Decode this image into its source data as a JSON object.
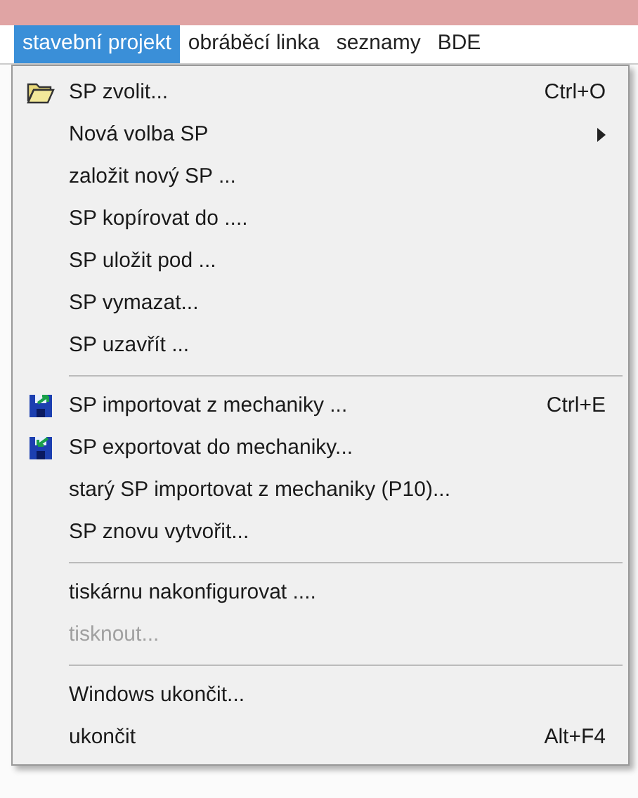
{
  "menubar": [
    {
      "label": "stavební projekt",
      "selected": true
    },
    {
      "label": "obráběcí linka",
      "selected": false
    },
    {
      "label": "seznamy",
      "selected": false
    },
    {
      "label": "BDE",
      "selected": false
    }
  ],
  "menu": [
    {
      "kind": "folder",
      "label": "SP zvolit...",
      "shortcut": "Ctrl+O",
      "disabled": false
    },
    {
      "kind": "item",
      "label": "Nová volba SP",
      "submenu": true,
      "disabled": false
    },
    {
      "kind": "item",
      "label": "založit nový SP ...",
      "disabled": false
    },
    {
      "kind": "item",
      "label": "SP kopírovat do ....",
      "disabled": false
    },
    {
      "kind": "item",
      "label": "SP uložit pod ...",
      "disabled": false
    },
    {
      "kind": "item",
      "label": "SP vymazat...",
      "disabled": false
    },
    {
      "kind": "item",
      "label": "SP uzavřít ...",
      "disabled": false
    },
    {
      "kind": "separator"
    },
    {
      "kind": "import",
      "label": "SP importovat z mechaniky ...",
      "shortcut": "Ctrl+E",
      "disabled": false
    },
    {
      "kind": "export",
      "label": "SP exportovat do mechaniky...",
      "disabled": false
    },
    {
      "kind": "item",
      "label": "starý SP importovat z mechaniky (P10)...",
      "disabled": false
    },
    {
      "kind": "item",
      "label": "SP znovu vytvořit...",
      "disabled": false
    },
    {
      "kind": "separator"
    },
    {
      "kind": "item",
      "label": "tiskárnu nakonfigurovat ....",
      "disabled": false
    },
    {
      "kind": "item",
      "label": "tisknout...",
      "disabled": true
    },
    {
      "kind": "separator"
    },
    {
      "kind": "item",
      "label": "Windows ukončit...",
      "disabled": false
    },
    {
      "kind": "item",
      "label": "ukončit",
      "shortcut": "Alt+F4",
      "disabled": false
    }
  ]
}
